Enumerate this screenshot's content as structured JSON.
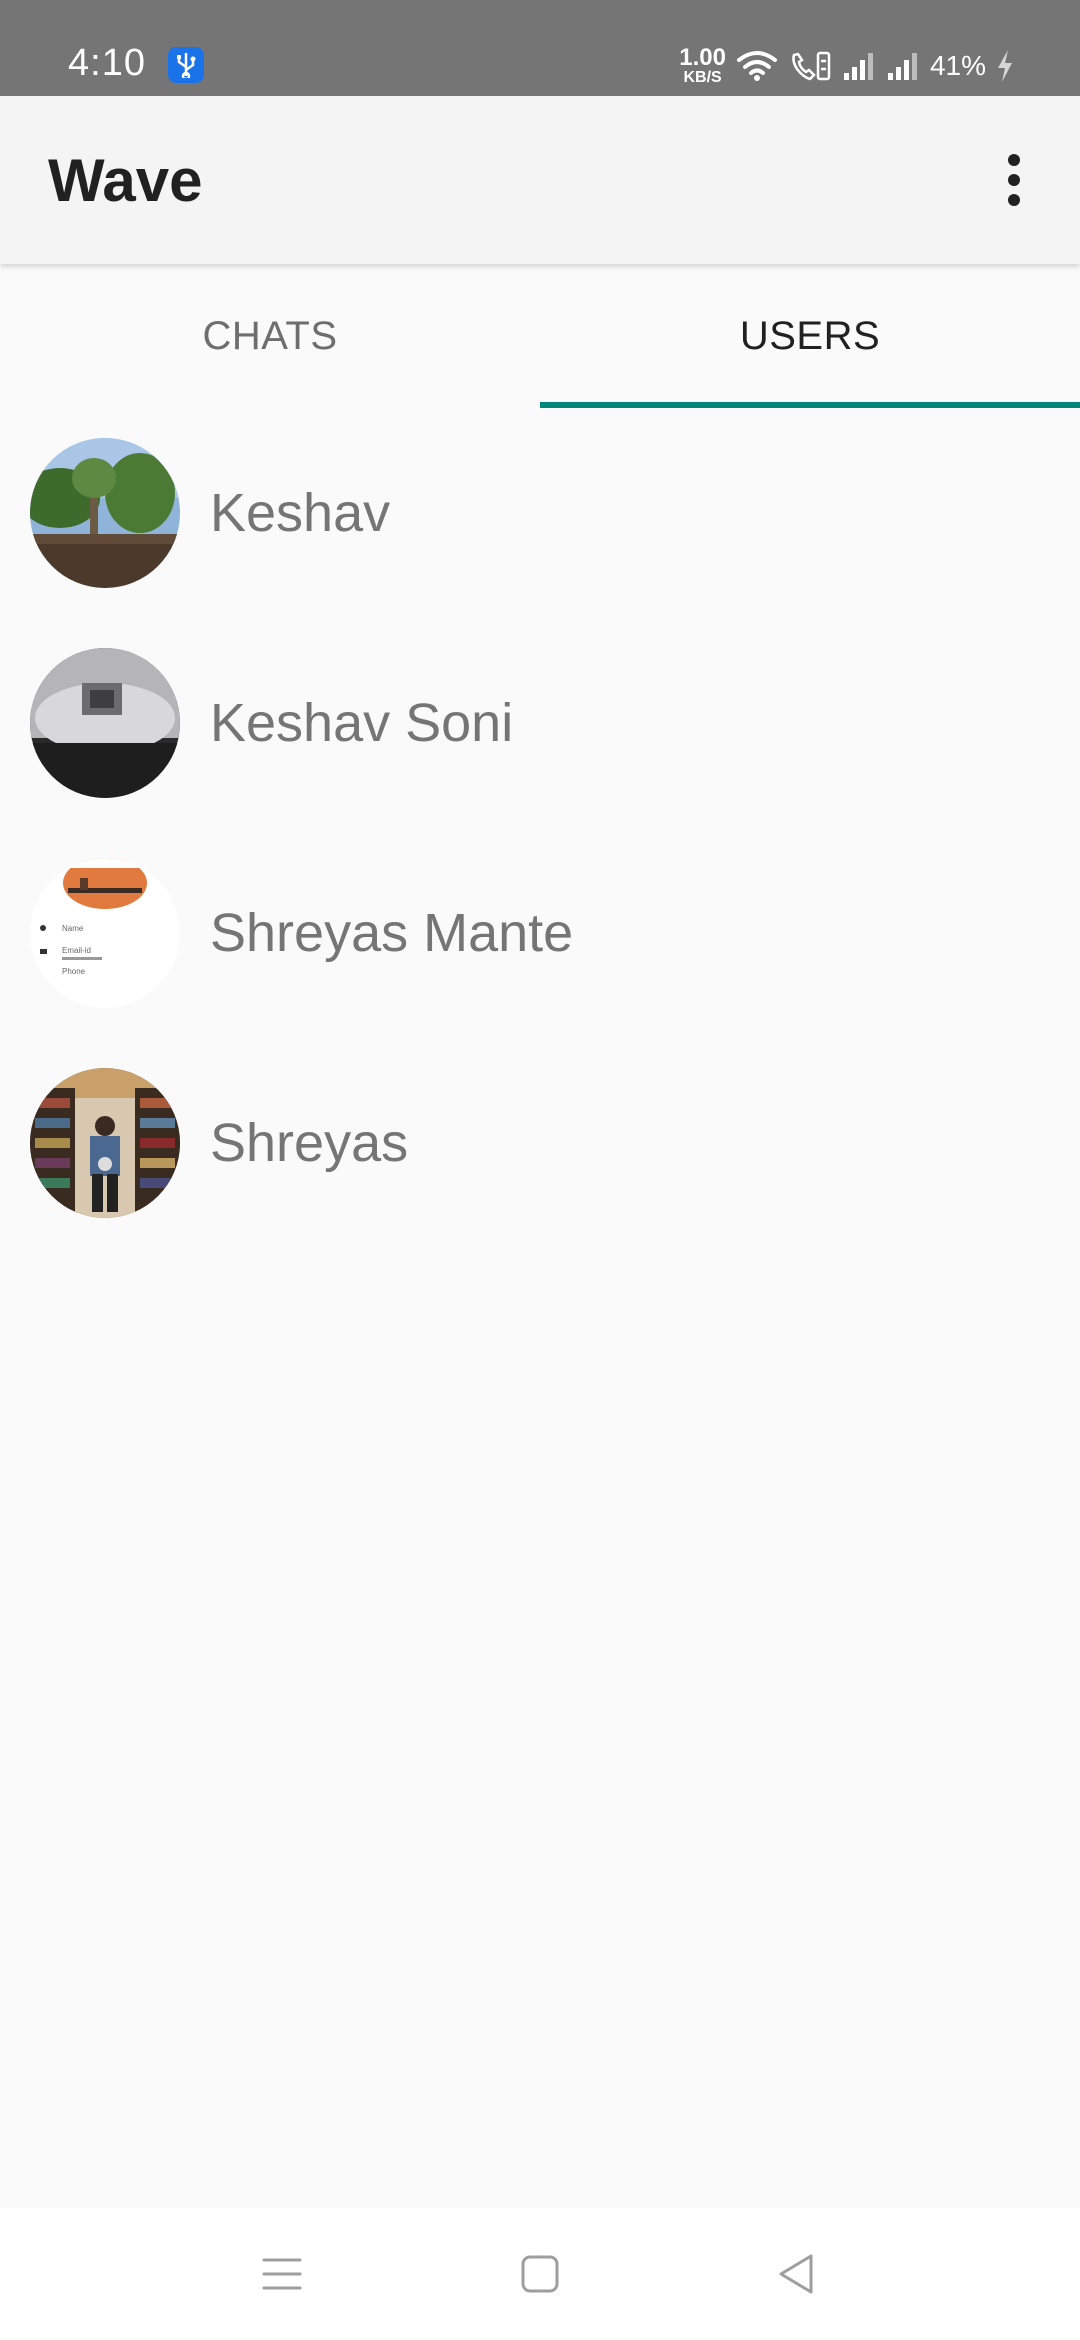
{
  "status_bar": {
    "time": "4:10",
    "net_speed_value": "1.00",
    "net_speed_unit": "KB/S",
    "battery": "41%",
    "icons": [
      "usb-icon",
      "wifi-icon",
      "volte-call-icon",
      "signal-icon",
      "signal-icon",
      "charging-icon"
    ]
  },
  "app_bar": {
    "title": "Wave",
    "overflow_icon": "more-vert-icon"
  },
  "tabs": [
    {
      "label": "CHATS",
      "selected": false
    },
    {
      "label": "USERS",
      "selected": true
    }
  ],
  "accent_color": "#00897b",
  "users": [
    {
      "name": "Keshav",
      "avatar": "landscape-photo"
    },
    {
      "name": "Keshav Soni",
      "avatar": "dark-photo"
    },
    {
      "name": "Shreyas Mante",
      "avatar": "profile-screenshot"
    },
    {
      "name": "Shreyas",
      "avatar": "library-photo"
    }
  ],
  "avatar_screenshot_text": {
    "name": "Name",
    "email": "Email-id",
    "phone": "Phone"
  },
  "nav_bar": {
    "icons": [
      "recents-icon",
      "home-icon",
      "back-icon"
    ]
  }
}
